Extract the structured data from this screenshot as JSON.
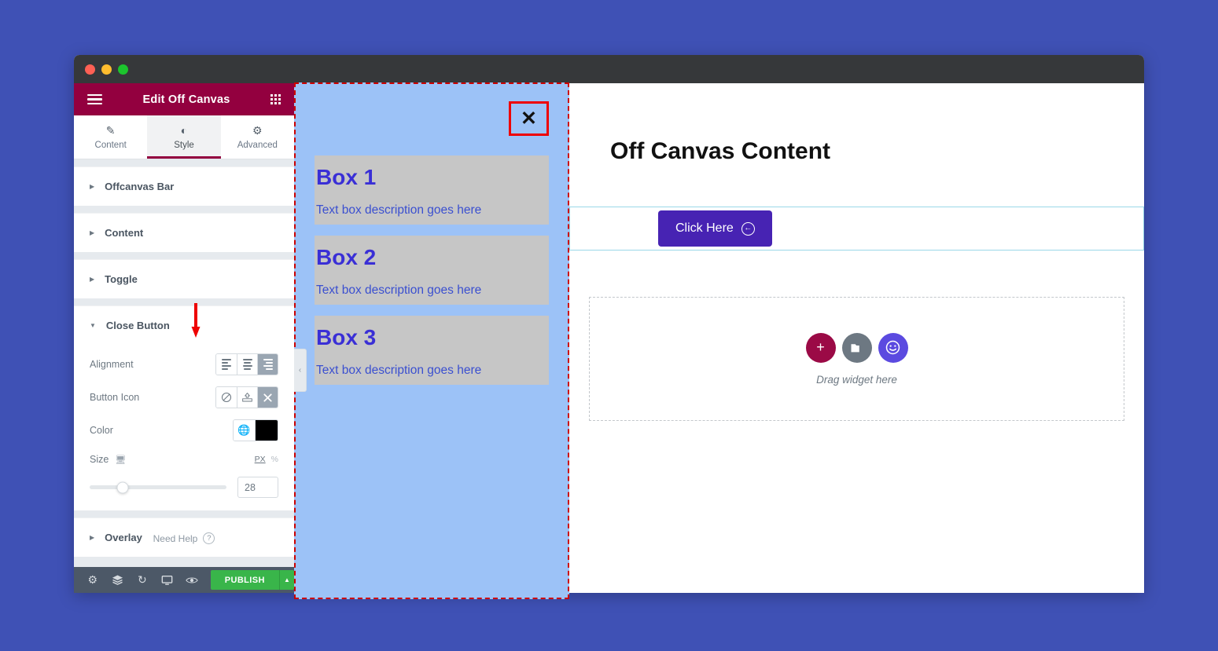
{
  "window": {
    "traffic_lights": [
      "close",
      "minimize",
      "maximize"
    ]
  },
  "panel": {
    "header": {
      "title": "Edit Off Canvas",
      "menu_icon": "hamburger-icon",
      "grid_icon": "grid-apps-icon"
    },
    "tabs": [
      {
        "label": "Content",
        "icon": "pencil-icon",
        "glyph": "✎",
        "active": false
      },
      {
        "label": "Style",
        "icon": "contrast-circle-icon",
        "glyph": "◐",
        "active": true
      },
      {
        "label": "Advanced",
        "icon": "gear-icon",
        "glyph": "⚙",
        "active": false
      }
    ],
    "sections": [
      {
        "label": "Offcanvas Bar",
        "expanded": false
      },
      {
        "label": "Content",
        "expanded": false
      },
      {
        "label": "Toggle",
        "expanded": false
      },
      {
        "label": "Close Button",
        "expanded": true
      },
      {
        "label": "Overlay",
        "expanded": false
      }
    ],
    "close_button_controls": {
      "alignment": {
        "label": "Alignment",
        "options": [
          "left",
          "center",
          "right"
        ],
        "selected": "right"
      },
      "button_icon": {
        "label": "Button Icon",
        "options": [
          "none",
          "upload",
          "close-x"
        ],
        "selected": "close-x"
      },
      "color": {
        "label": "Color",
        "globe_icon": "globe-icon",
        "value": "#000000"
      },
      "size": {
        "label": "Size",
        "device_icon": "monitor-icon",
        "units": [
          "PX",
          "%"
        ],
        "selected_unit": "PX",
        "value": "28",
        "slider_percent": 24
      }
    },
    "need_help": {
      "label": "Need Help",
      "icon": "question-mark-icon"
    },
    "footer": {
      "icons": [
        {
          "name": "settings-gear-icon",
          "glyph": "⚙"
        },
        {
          "name": "layers-navigator-icon",
          "glyph": "≣"
        },
        {
          "name": "history-revisions-icon",
          "glyph": "↺"
        },
        {
          "name": "responsive-monitor-icon",
          "glyph": "▭"
        },
        {
          "name": "preview-eye-icon",
          "glyph": "◉"
        }
      ],
      "publish_label": "PUBLISH",
      "publish_arrow": "▲"
    }
  },
  "canvas": {
    "collapse_handle": "‹",
    "offcanvas": {
      "close_x": "✕",
      "boxes": [
        {
          "title": "Box 1",
          "description": "Text box description goes here"
        },
        {
          "title": "Box 2",
          "description": "Text box description goes here"
        },
        {
          "title": "Box 3",
          "description": "Text box description goes here"
        }
      ]
    },
    "content": {
      "heading": "Off Canvas Content",
      "button": {
        "label": "Click Here",
        "icon": "circle-arrow-left-icon",
        "glyph": "←"
      },
      "dropzone": {
        "text": "Drag widget here",
        "widgets": [
          {
            "name": "add-widget-icon",
            "glyph": "+",
            "color": "#9b0a46"
          },
          {
            "name": "folder-template-icon",
            "glyph": "▰",
            "color": "#6d7882"
          },
          {
            "name": "smiley-widget-icon",
            "glyph": "☺",
            "color": "#5b4ae0"
          }
        ]
      }
    }
  },
  "colors": {
    "desktop_background": "#3f51b5",
    "panel_header": "#93003f",
    "publish_green": "#39b54a",
    "offcanvas_blue": "#9cc2f7",
    "box_gray": "#c6c6c6",
    "box_title_purple": "#3a2fd6",
    "click_button_purple": "#4723b3",
    "annotation_red": "#ee0000"
  }
}
